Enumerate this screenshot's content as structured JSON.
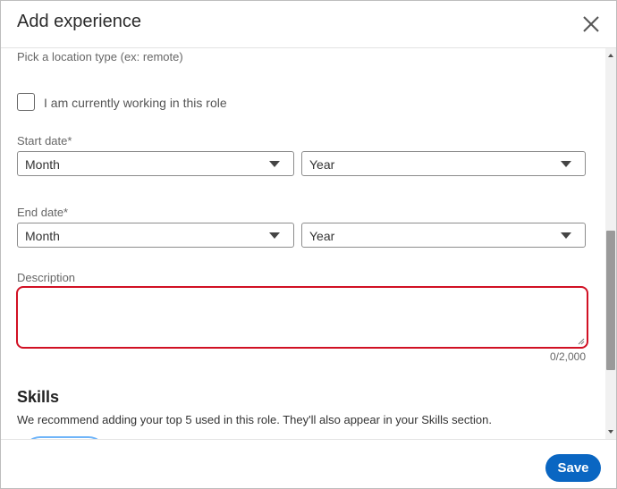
{
  "dialog": {
    "title": "Add experience",
    "close_icon": "close-icon"
  },
  "form": {
    "location_hint": "Pick a location type (ex: remote)",
    "current_role_label": "I am currently working in this role",
    "current_role_checked": false,
    "start_date": {
      "label": "Start date*",
      "month": "Month",
      "year": "Year"
    },
    "end_date": {
      "label": "End date*",
      "month": "Month",
      "year": "Year"
    },
    "description": {
      "label": "Description",
      "value": "",
      "counter": "0/2,000",
      "error_color": "#d11124"
    },
    "skills": {
      "title": "Skills",
      "description": "We recommend adding your top 5 used in this role. They'll also appear in your Skills section."
    }
  },
  "footer": {
    "save_label": "Save",
    "save_color": "#0a66c2"
  }
}
